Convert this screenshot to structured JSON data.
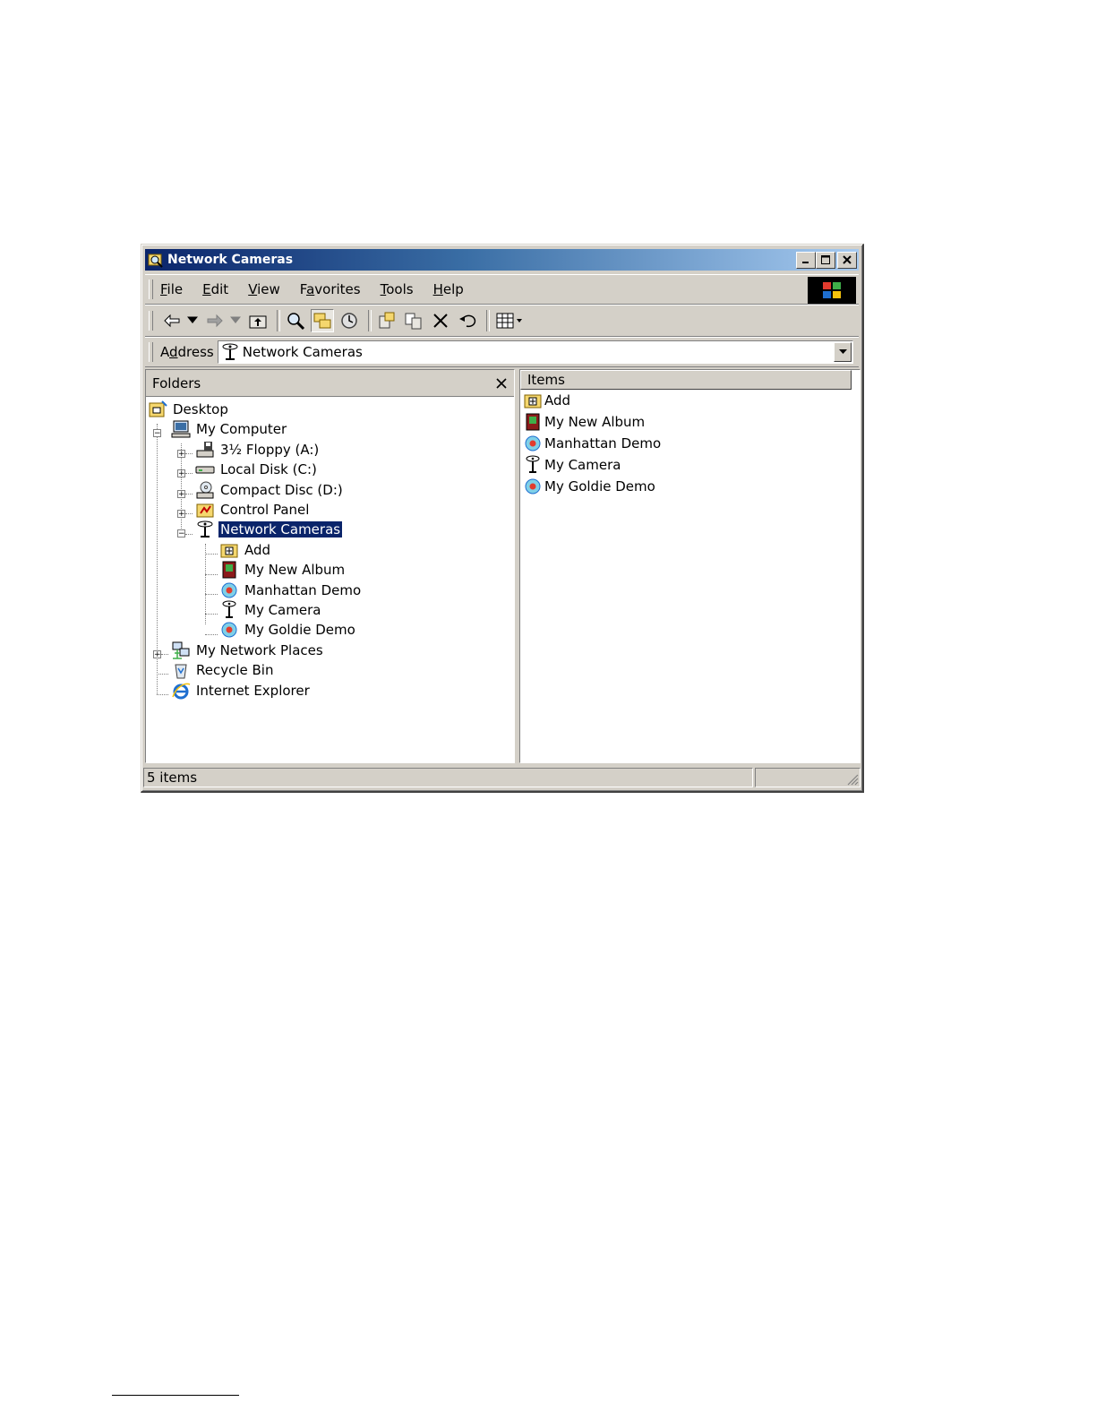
{
  "window": {
    "title": "Network Cameras",
    "title_icon": "explorer-search-icon",
    "buttons": [
      "minimize",
      "maximize",
      "close"
    ]
  },
  "menu": {
    "items": [
      {
        "label": "File",
        "accel": "F",
        "rest": "ile"
      },
      {
        "label": "Edit",
        "accel": "E",
        "rest": "dit"
      },
      {
        "label": "View",
        "accel": "V",
        "rest": "iew"
      },
      {
        "label": "Favorites",
        "pre": "F",
        "accel": "a",
        "rest": "vorites"
      },
      {
        "label": "Tools",
        "accel": "T",
        "rest": "ools"
      },
      {
        "label": "Help",
        "accel": "H",
        "rest": "elp"
      }
    ]
  },
  "toolbar": {
    "buttons": [
      "back-icon",
      "forward-icon",
      "up-folder-icon",
      "search-icon",
      "folders-icon",
      "history-icon",
      "move-to-icon",
      "copy-to-icon",
      "delete-icon",
      "undo-icon",
      "views-icon"
    ]
  },
  "address": {
    "label_pre": "A",
    "label_accel": "d",
    "label_rest": "dress",
    "value": "Network Cameras"
  },
  "folders": {
    "header": "Folders",
    "tree": {
      "desktop": "Desktop",
      "my_computer": "My Computer",
      "floppy": "3½ Floppy (A:)",
      "local_disk": "Local Disk (C:)",
      "compact_disc": "Compact Disc (D:)",
      "control_panel": "Control Panel",
      "network_cameras": "Network Cameras",
      "add": "Add",
      "my_new_album": "My New Album",
      "manhattan_demo": "Manhattan Demo",
      "my_camera": "My Camera",
      "my_goldie_demo": "My Goldie Demo",
      "my_network_places": "My Network Places",
      "recycle_bin": "Recycle Bin",
      "internet_explorer": "Internet Explorer"
    }
  },
  "items": {
    "header": "Items",
    "list": [
      "Add",
      "My New Album",
      "Manhattan Demo",
      "My Camera",
      "My Goldie Demo"
    ]
  },
  "status": {
    "text": "5 items"
  }
}
